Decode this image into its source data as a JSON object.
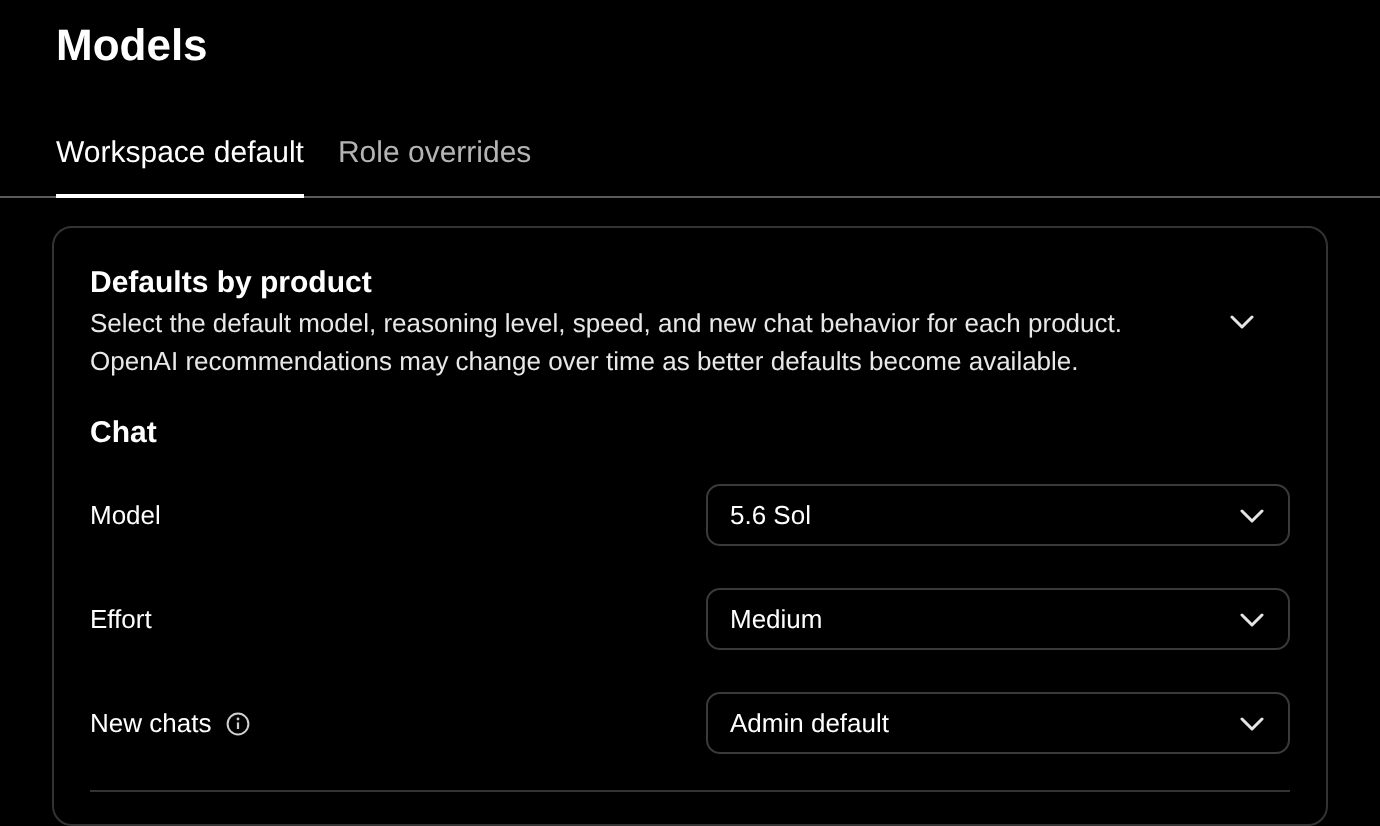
{
  "page": {
    "title": "Models"
  },
  "tabs": [
    {
      "label": "Workspace default",
      "selected": true
    },
    {
      "label": "Role overrides",
      "selected": false
    }
  ],
  "card": {
    "title": "Defaults by product",
    "description": [
      "Select the default model, reasoning level, speed, and new chat behavior for each product.",
      "OpenAI recommendations may change over time as better defaults become available."
    ],
    "section": "Chat",
    "fields": [
      {
        "label": "Model",
        "value": "5.6 Sol",
        "info": false
      },
      {
        "label": "Effort",
        "value": "Medium",
        "info": false
      },
      {
        "label": "New chats",
        "value": "Admin default",
        "info": true
      }
    ]
  }
}
